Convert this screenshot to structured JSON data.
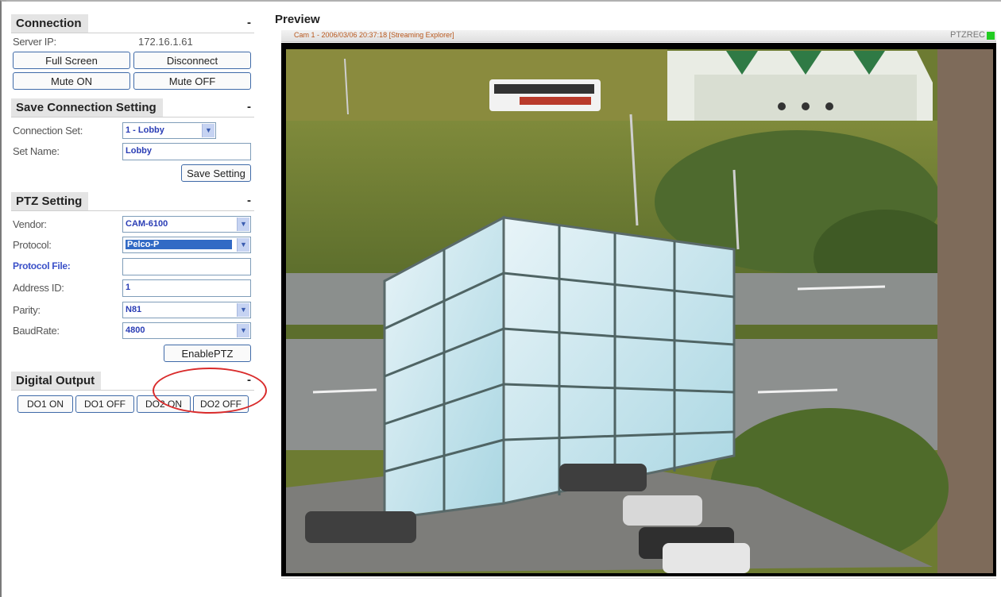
{
  "connection": {
    "title": "Connection",
    "minimize": "-",
    "server_ip_label": "Server IP:",
    "server_ip": "172.16.1.61",
    "full_screen": "Full Screen",
    "disconnect": "Disconnect",
    "mute_on": "Mute ON",
    "mute_off": "Mute OFF"
  },
  "save_connection": {
    "title": "Save Connection Setting",
    "minimize": "-",
    "connection_set_label": "Connection Set:",
    "connection_set_value": "1 - Lobby",
    "set_name_label": "Set Name:",
    "set_name_value": "Lobby",
    "save_button": "Save Setting"
  },
  "ptz": {
    "title": "PTZ Setting",
    "minimize": "-",
    "vendor_label": "Vendor:",
    "vendor_value": "CAM-6100",
    "protocol_label": "Protocol:",
    "protocol_value": "Pelco-P",
    "protocol_file_label": "Protocol File:",
    "protocol_file_value": "",
    "address_label": "Address ID:",
    "address_value": "1",
    "parity_label": "Parity:",
    "parity_value": "N81",
    "baud_label": "BaudRate:",
    "baud_value": "4800",
    "enable_button": "EnablePTZ"
  },
  "digital_output": {
    "title": "Digital Output",
    "minimize": "-",
    "buttons": [
      "DO1 ON",
      "DO1 OFF",
      "DO2 ON",
      "DO2 OFF"
    ]
  },
  "preview": {
    "title": "Preview",
    "cam_info": "Cam 1 - 2006/03/06 20:37:18 [Streaming Explorer]",
    "status_text": "PTZREC",
    "status_color": "#22cc22"
  },
  "colors": {
    "button_border": "#3f6aa8",
    "highlight_circle": "#d92b2b",
    "selection_blue": "#316ac5"
  }
}
